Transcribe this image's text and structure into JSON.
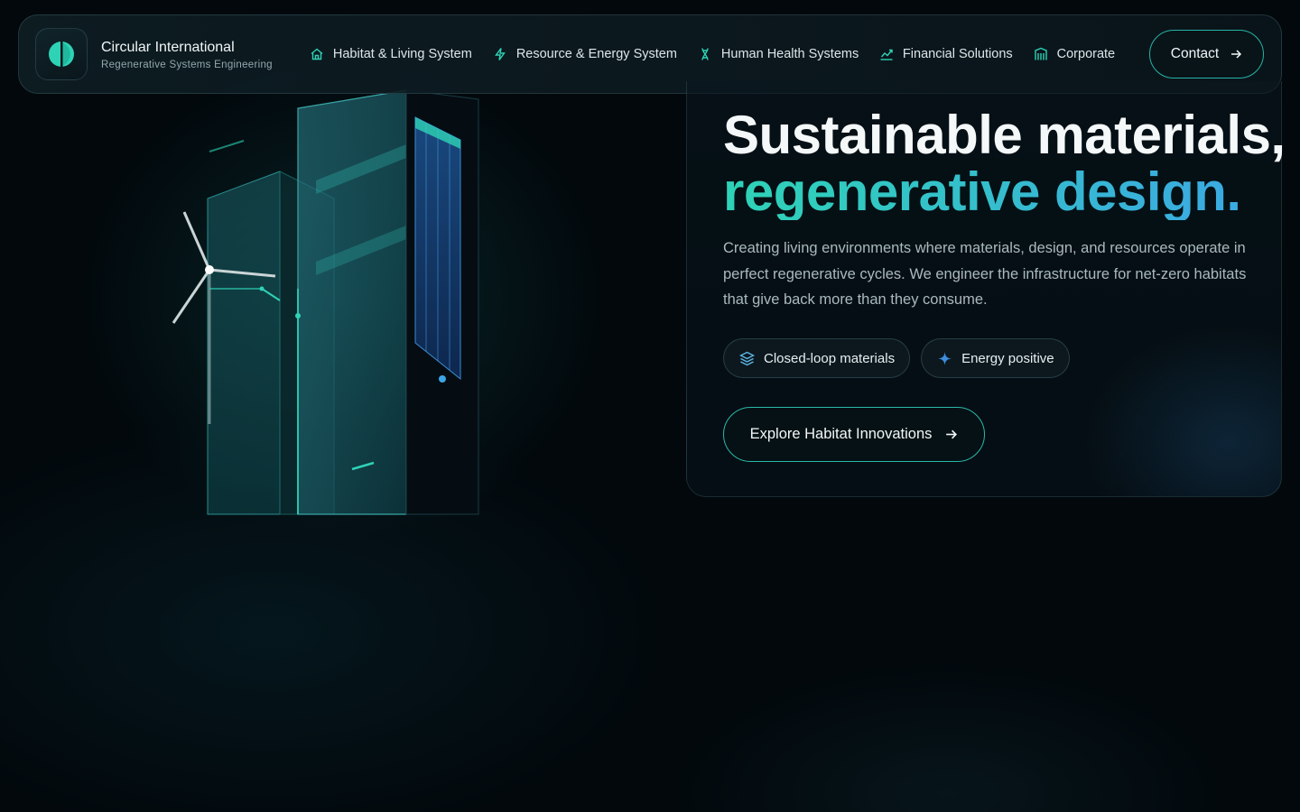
{
  "brand": {
    "title": "Circular International",
    "subtitle": "Regenerative Systems Engineering",
    "logo_icon": "half-circle-logo-icon"
  },
  "nav": {
    "items": [
      {
        "label": "Habitat & Living System",
        "icon": "home-icon"
      },
      {
        "label": "Resource & Energy System",
        "icon": "lightning-icon"
      },
      {
        "label": "Human Health Systems",
        "icon": "dna-icon"
      },
      {
        "label": "Financial Solutions",
        "icon": "chart-icon"
      },
      {
        "label": "Corporate",
        "icon": "building-icon"
      }
    ],
    "contact_label": "Contact"
  },
  "hero": {
    "headline_line1": "Sustainable materials,",
    "headline_line2": "regenerative design.",
    "description": "Creating living environments where materials, design, and resources operate in perfect regenerative cycles. We engineer the infrastructure for net-zero habitats that give back more than they consume.",
    "chips": [
      {
        "label": "Closed-loop materials",
        "icon": "layers-icon"
      },
      {
        "label": "Energy positive",
        "icon": "sparkle-icon"
      }
    ],
    "cta_label": "Explore Habitat Innovations"
  },
  "colors": {
    "accent_teal": "#2ed3b6",
    "accent_blue": "#3ca6e6",
    "background": "#02080c",
    "border_accent": "#27b3a6"
  }
}
